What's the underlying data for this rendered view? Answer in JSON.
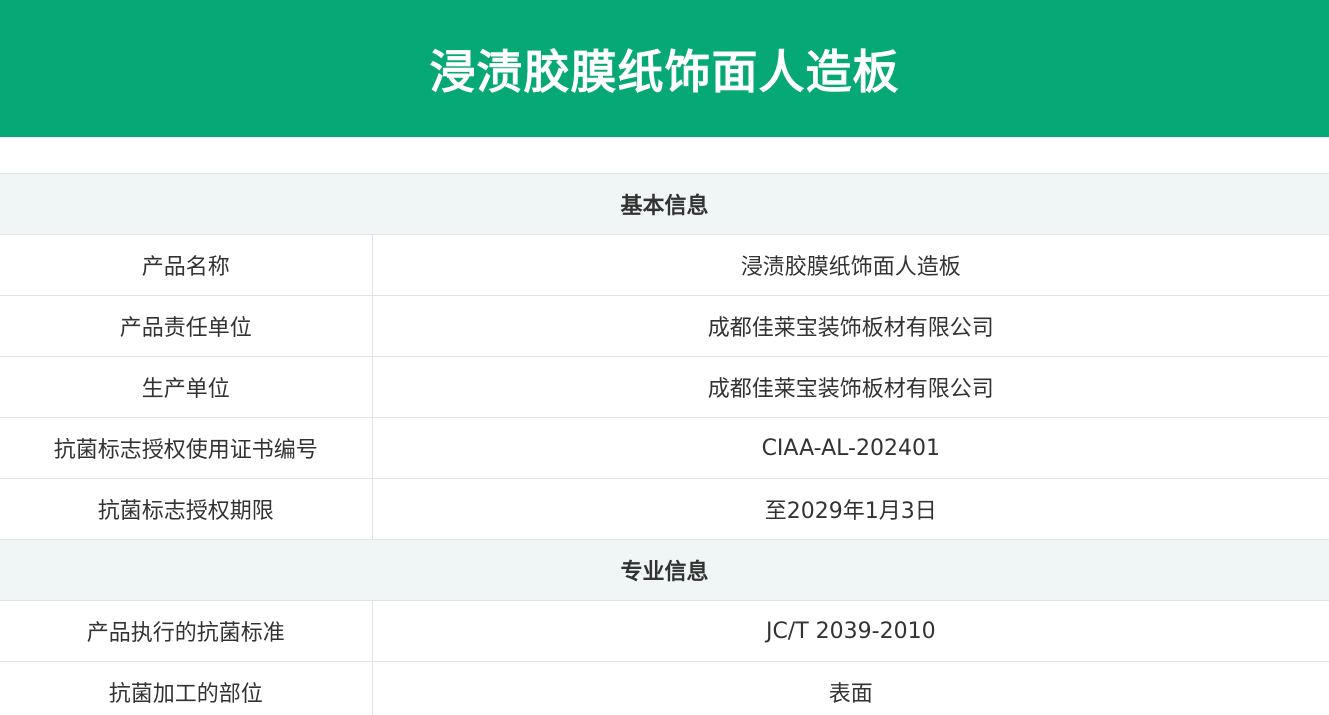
{
  "title": "浸渍胶膜纸饰面人造板",
  "sections": [
    {
      "heading": "基本信息",
      "rows": [
        {
          "label": "产品名称",
          "value": "浸渍胶膜纸饰面人造板"
        },
        {
          "label": "产品责任单位",
          "value": "成都佳莱宝装饰板材有限公司"
        },
        {
          "label": "生产单位",
          "value": "成都佳莱宝装饰板材有限公司"
        },
        {
          "label": "抗菌标志授权使用证书编号",
          "value": "CIAA-AL-202401"
        },
        {
          "label": "抗菌标志授权期限",
          "value": "至2029年1月3日"
        }
      ]
    },
    {
      "heading": "专业信息",
      "rows": [
        {
          "label": "产品执行的抗菌标准",
          "value": "JC/T 2039-2010"
        },
        {
          "label": "抗菌加工的部位",
          "value": "表面"
        }
      ]
    }
  ],
  "colors": {
    "header_bg": "#06a975",
    "section_bg": "#eff6f5",
    "border": "#dfe6e4",
    "text": "#333333"
  }
}
